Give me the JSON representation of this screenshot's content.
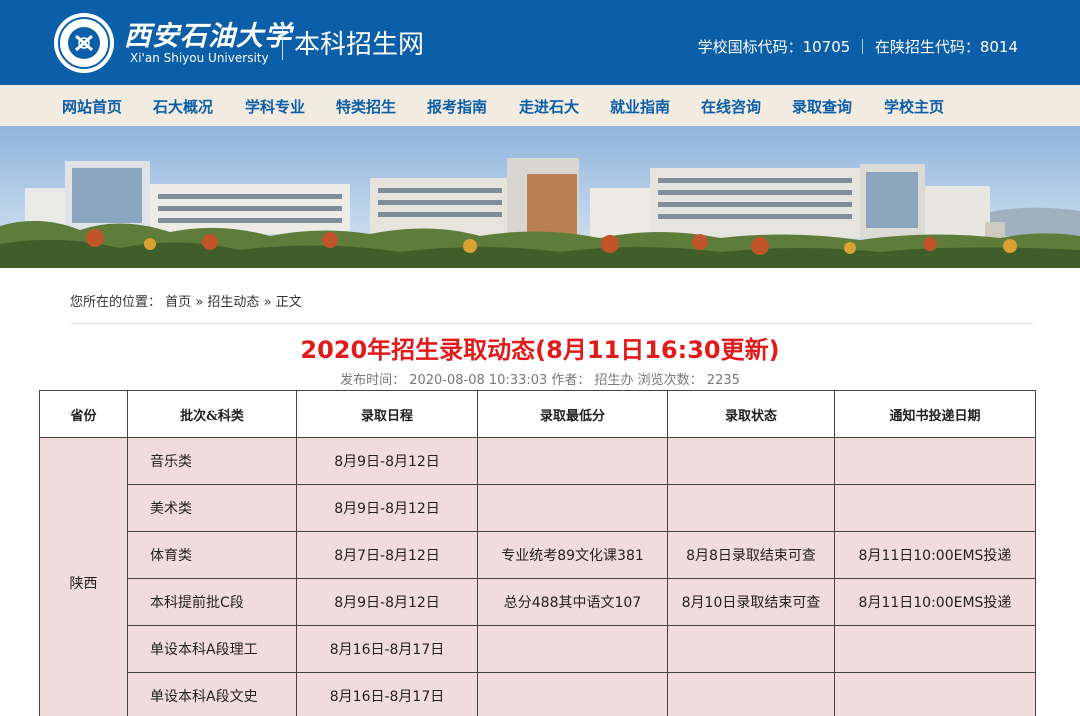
{
  "header": {
    "university_cn": "西安石油大学",
    "university_en": "Xi'an Shiyou University",
    "site_title": "本科招生网",
    "codes": "学校国标代码：10705 ｜ 在陕招生代码：8014",
    "bg_color": "#0b5ea8"
  },
  "nav": {
    "items": [
      {
        "label": "网站首页"
      },
      {
        "label": "石大概况"
      },
      {
        "label": "学科专业"
      },
      {
        "label": "特类招生"
      },
      {
        "label": "报考指南"
      },
      {
        "label": "走进石大"
      },
      {
        "label": "就业指南"
      },
      {
        "label": "在线咨询"
      },
      {
        "label": "录取查询"
      },
      {
        "label": "学校主页"
      }
    ]
  },
  "breadcrumb": {
    "prefix": "您所在的位置：",
    "home": "首页",
    "sep1": "»",
    "section": "招生动态",
    "sep2": "»",
    "current": "正文"
  },
  "article": {
    "title": "2020年招生录取动态(8月11日16:30更新)",
    "meta": "发布时间：  2020-08-08 10:33:03   作者：  招生办   浏览次数：  2235"
  },
  "table": {
    "headers": [
      "省份",
      "批次&科类",
      "录取日程",
      "录取最低分",
      "录取状态",
      "通知书投递日期"
    ],
    "province": "陕西",
    "rows": [
      {
        "batch": "音乐类",
        "schedule": "8月9日-8月12日",
        "min_score": "",
        "status": "",
        "notice": ""
      },
      {
        "batch": "美术类",
        "schedule": "8月9日-8月12日",
        "min_score": "",
        "status": "",
        "notice": ""
      },
      {
        "batch": "体育类",
        "schedule": "8月7日-8月12日",
        "min_score": "专业统考89文化课381",
        "status": "8月8日录取结束可查",
        "notice": "8月11日10:00EMS投递"
      },
      {
        "batch": "本科提前批C段",
        "schedule": "8月9日-8月12日",
        "min_score": "总分488其中语文107",
        "status": "8月10日录取结束可查",
        "notice": "8月11日10:00EMS投递"
      },
      {
        "batch": "单设本科A段理工",
        "schedule": "8月16日-8月17日",
        "min_score": "",
        "status": "",
        "notice": ""
      },
      {
        "batch": "单设本科A段文史",
        "schedule": "8月16日-8月17日",
        "min_score": "",
        "status": "",
        "notice": ""
      }
    ]
  }
}
